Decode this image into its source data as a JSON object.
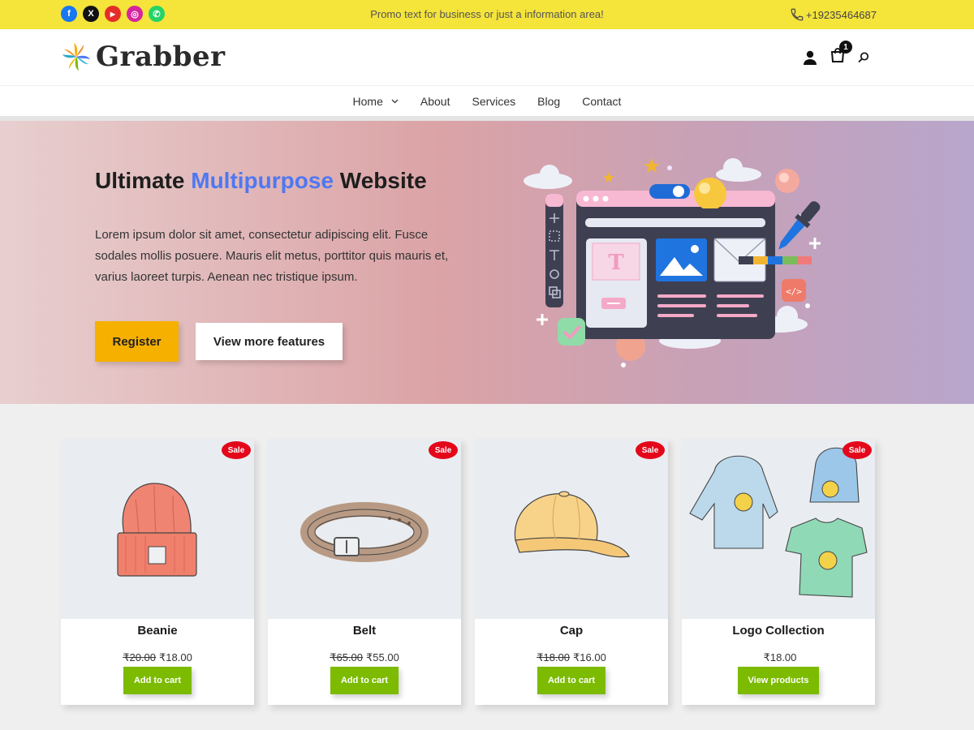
{
  "topbar": {
    "social": [
      {
        "name": "facebook-icon",
        "glyph": "f",
        "color": "#1877f2"
      },
      {
        "name": "x-icon",
        "glyph": "X",
        "color": "#111111"
      },
      {
        "name": "youtube-icon",
        "glyph": "▶",
        "color": "#e52d27"
      },
      {
        "name": "instagram-icon",
        "glyph": "◎",
        "color": "#d6249f"
      },
      {
        "name": "whatsapp-icon",
        "glyph": "✆",
        "color": "#25d366"
      }
    ],
    "promo": "Promo text for business or just a information area!",
    "phone": "+19235464687"
  },
  "header": {
    "logo_text": "Grabber",
    "cart_count": "1"
  },
  "nav": {
    "items": [
      "Home",
      "About",
      "Services",
      "Blog",
      "Contact"
    ]
  },
  "hero": {
    "title_pre": "Ultimate ",
    "title_highlight": "Multipurpose",
    "title_post": " Website",
    "text": "Lorem ipsum dolor sit amet, consectetur adipiscing elit. Fusce sodales mollis posuere. Mauris elit metus, porttitor quis mauris et, varius laoreet turpis. Aenean nec tristique ipsum.",
    "register_label": "Register",
    "more_label": "View more features"
  },
  "products": [
    {
      "name": "Beanie",
      "old_price": "₹20.00",
      "price": "₹18.00",
      "sale": "Sale",
      "button": "Add to cart"
    },
    {
      "name": "Belt",
      "old_price": "₹65.00",
      "price": "₹55.00",
      "sale": "Sale",
      "button": "Add to cart"
    },
    {
      "name": "Cap",
      "old_price": "₹18.00",
      "price": "₹16.00",
      "sale": "Sale",
      "button": "Add to cart"
    },
    {
      "name": "Logo Collection",
      "old_price": "",
      "price": "₹18.00",
      "sale": "Sale",
      "button": "View products"
    }
  ],
  "colors": {
    "topbar": "#f5e43a",
    "accent_blue": "#4f78f0",
    "register": "#f6b000",
    "cart_button": "#7cbb00",
    "sale_badge": "#e4071a"
  }
}
